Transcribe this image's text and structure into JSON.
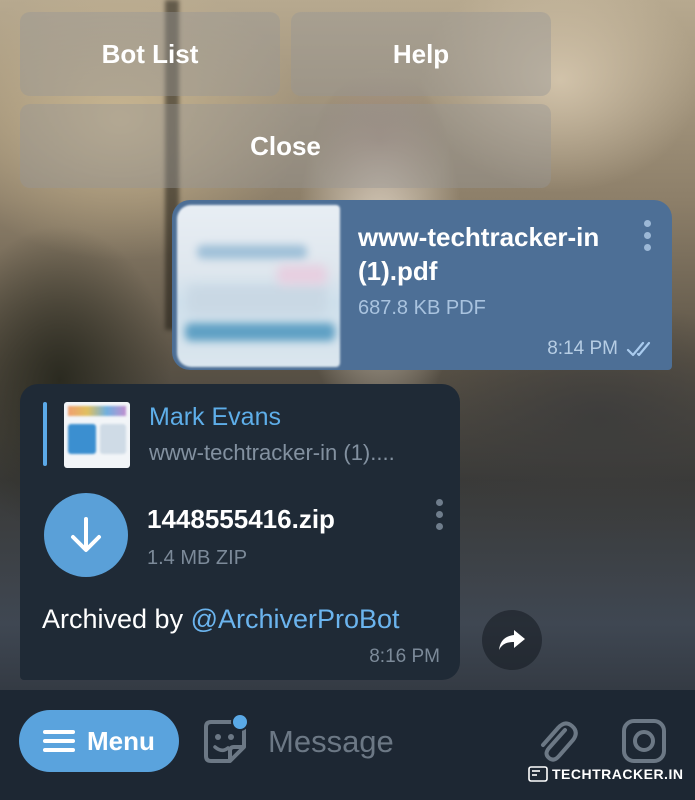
{
  "bot_keyboard": {
    "buttons": [
      "Bot List",
      "Help",
      "Close"
    ]
  },
  "outgoing_message": {
    "file_name": "www-techtracker-in (1).pdf",
    "file_meta": "687.8 KB PDF",
    "time": "8:14 PM",
    "status_icon": "double-check-icon"
  },
  "incoming_message": {
    "reply": {
      "sender": "Mark Evans",
      "file_name": "www-techtracker-in (1)...."
    },
    "file_name": "1448555416.zip",
    "file_meta": "1.4 MB ZIP",
    "caption_prefix": "Archived by ",
    "caption_mention": "@ArchiverProBot",
    "time": "8:16 PM"
  },
  "composer": {
    "menu_label": "Menu",
    "placeholder": "Message"
  },
  "watermark": "TECHTRACKER.IN",
  "colors": {
    "outgoing_bubble": "#4d6f96",
    "incoming_bubble": "#1f2a36",
    "accent": "#5aa3dd",
    "link": "#6bb4ee",
    "bottom_bar": "#1d2733"
  }
}
